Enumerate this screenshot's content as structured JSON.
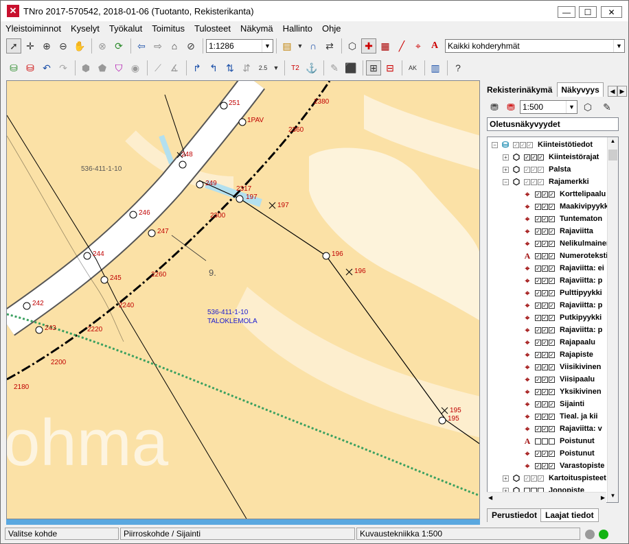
{
  "window": {
    "title": "TNro 2017-570542, 2018-01-06 (Tuotanto, Rekisterikanta)",
    "app_icon": "TN"
  },
  "menu": [
    "Yleistoiminnot",
    "Kyselyt",
    "Työkalut",
    "Toimitus",
    "Tulosteet",
    "Näkymä",
    "Hallinto",
    "Ohje"
  ],
  "toolbar1": {
    "scale_value": "1:1286",
    "group_value": "Kaikki kohderyhmät"
  },
  "map": {
    "labels": [
      {
        "id": "lbl251",
        "text": "251"
      },
      {
        "id": "lbl1pav",
        "text": "1PAV"
      },
      {
        "id": "lbl2380",
        "text": "2380"
      },
      {
        "id": "lbl2360",
        "text": "2360"
      },
      {
        "id": "lbl248",
        "text": "248"
      },
      {
        "id": "lbl249",
        "text": "249"
      },
      {
        "id": "lbl2317",
        "text": "2317"
      },
      {
        "id": "lbl197a",
        "text": "197"
      },
      {
        "id": "lbl197b",
        "text": "197"
      },
      {
        "id": "lbl246",
        "text": "246"
      },
      {
        "id": "lbl2300",
        "text": "2300"
      },
      {
        "id": "lbl247",
        "text": "247"
      },
      {
        "id": "lbl196a",
        "text": "196"
      },
      {
        "id": "lbl196b",
        "text": "196"
      },
      {
        "id": "lbl244",
        "text": "244"
      },
      {
        "id": "lbl245",
        "text": "245"
      },
      {
        "id": "lbl2260",
        "text": "2260"
      },
      {
        "id": "lbl242",
        "text": "242"
      },
      {
        "id": "lbl2240",
        "text": "2240"
      },
      {
        "id": "lbl243",
        "text": "243"
      },
      {
        "id": "lbl2220",
        "text": "2220"
      },
      {
        "id": "lbl2200",
        "text": "2200"
      },
      {
        "id": "lbl2180",
        "text": "2180"
      },
      {
        "id": "lbl195a",
        "text": "195"
      },
      {
        "id": "lbl195b",
        "text": "195"
      }
    ],
    "parcel_id_top": "536-411-1-10",
    "parcel_id": "536-411-1-10",
    "parcel_name": "TALOKLEMOLA",
    "area_number": "9.",
    "background_text": "ohma"
  },
  "panel": {
    "tabs": [
      "Rekisterinäkymä",
      "Näkyvyys"
    ],
    "scale_value": "1:500",
    "visibility_set": "Oletusnäkyvyydet",
    "tree": [
      {
        "label": "Kiinteistötiedot",
        "expander": "−",
        "icon": "cylinder-icon",
        "checks": "grey",
        "indent": 0
      },
      {
        "label": "Kiinteistörajat",
        "expander": "+",
        "icon": "cube-icon",
        "checks": "on",
        "indent": 1
      },
      {
        "label": "Palsta",
        "expander": "+",
        "icon": "cube-icon",
        "checks": "grey",
        "indent": 1
      },
      {
        "label": "Rajamerkki",
        "expander": "−",
        "icon": "cube-icon",
        "checks": "grey",
        "indent": 1
      },
      {
        "label": "Korttelipaalu",
        "icon": "crosshair-icon",
        "checks": "on",
        "indent": 2
      },
      {
        "label": "Maakivipyykki",
        "icon": "crosshair-icon",
        "checks": "on",
        "indent": 2
      },
      {
        "label": "Tuntematon",
        "icon": "crosshair-icon",
        "checks": "on",
        "indent": 2
      },
      {
        "label": "Rajaviitta",
        "icon": "crosshair-icon",
        "checks": "on",
        "indent": 2
      },
      {
        "label": "Nelikulmainen",
        "icon": "crosshair-icon",
        "checks": "on",
        "indent": 2
      },
      {
        "label": "Numerotekstit",
        "icon": "text-icon",
        "checks": "on",
        "indent": 2
      },
      {
        "label": "Rajaviitta: ei",
        "icon": "crosshair-icon",
        "checks": "on",
        "indent": 2
      },
      {
        "label": "Rajaviitta: p",
        "icon": "crosshair-icon",
        "checks": "on",
        "indent": 2
      },
      {
        "label": "Pulttipyykki",
        "icon": "crosshair-icon",
        "checks": "on",
        "indent": 2
      },
      {
        "label": "Rajaviitta: p",
        "icon": "crosshair-icon",
        "checks": "on",
        "indent": 2
      },
      {
        "label": "Putkipyykki",
        "icon": "crosshair-icon",
        "checks": "on",
        "indent": 2
      },
      {
        "label": "Rajaviitta: p",
        "icon": "crosshair-icon",
        "checks": "on",
        "indent": 2
      },
      {
        "label": "Rajapaalu",
        "icon": "crosshair-icon",
        "checks": "on",
        "indent": 2
      },
      {
        "label": "Rajapiste",
        "icon": "crosshair-icon",
        "checks": "on",
        "indent": 2
      },
      {
        "label": "Viisikivinen",
        "icon": "crosshair-icon",
        "checks": "on",
        "indent": 2
      },
      {
        "label": "Viisipaalu",
        "icon": "crosshair-icon",
        "checks": "on",
        "indent": 2
      },
      {
        "label": "Yksikivinen",
        "icon": "crosshair-icon",
        "checks": "on",
        "indent": 2
      },
      {
        "label": "Sijainti",
        "icon": "crosshair-icon",
        "checks": "on",
        "indent": 2
      },
      {
        "label": "Tieal. ja kii",
        "icon": "crosshair-icon",
        "checks": "on",
        "indent": 2
      },
      {
        "label": "Rajaviitta: v",
        "icon": "crosshair-icon",
        "checks": "on",
        "indent": 2
      },
      {
        "label": "Poistunut",
        "icon": "text-icon",
        "checks": "off",
        "indent": 2
      },
      {
        "label": "Poistunut",
        "icon": "crosshair-icon",
        "checks": "on",
        "indent": 2
      },
      {
        "label": "Varastopiste",
        "icon": "crosshair-icon",
        "checks": "on",
        "indent": 2
      },
      {
        "label": "Kartoituspisteet",
        "expander": "+",
        "icon": "cube-icon",
        "checks": "grey",
        "indent": 1
      },
      {
        "label": "Jonopiste",
        "expander": "+",
        "icon": "cube-icon",
        "checks": "off",
        "indent": 1
      }
    ],
    "bottom_tabs": [
      "Perustiedot",
      "Laajat tiedot"
    ]
  },
  "status": {
    "left": "Valitse kohde",
    "middle": "Piirroskohde / Sijainti",
    "right": "Kuvaustekniikka 1:500"
  },
  "colors": {
    "map_bg": "#fbe1a6",
    "label_red": "#c00000",
    "label_blue": "#1a1ad0",
    "road": "#ffffff"
  }
}
